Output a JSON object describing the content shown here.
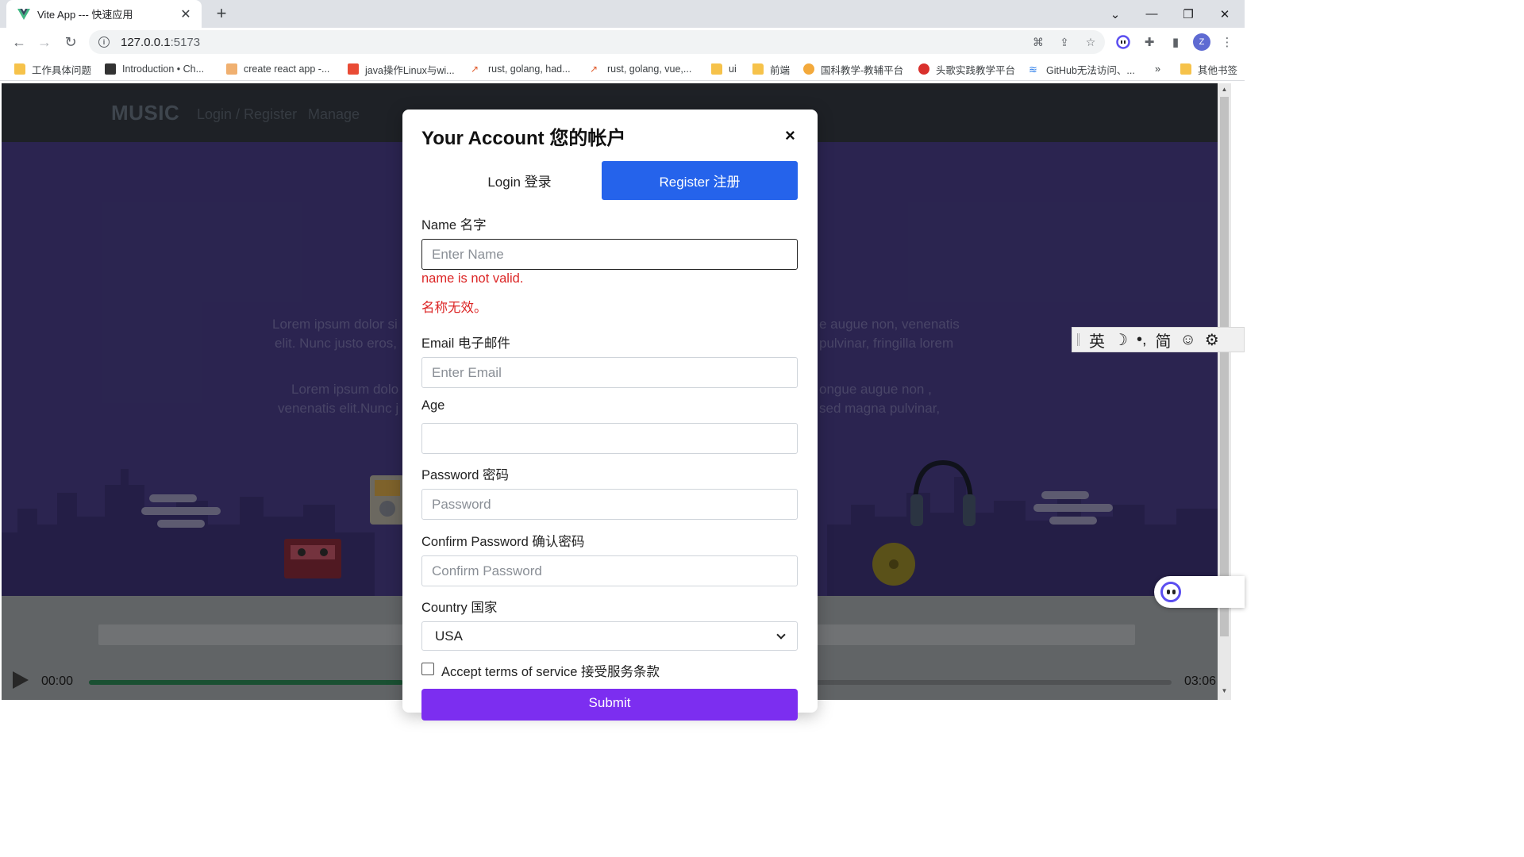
{
  "browser": {
    "tab_title": "Vite App --- 快速应用",
    "url_host": "127.0.0.1",
    "url_port": ":5173",
    "profile_initial": "Z"
  },
  "bookmarks": [
    {
      "label": "工作具体问题",
      "icon": "folder"
    },
    {
      "label": "Introduction • Ch...",
      "icon": "site"
    },
    {
      "label": "create react app -...",
      "icon": "site"
    },
    {
      "label": "java操作Linux与wi...",
      "icon": "site"
    },
    {
      "label": "rust, golang, had...",
      "icon": "site"
    },
    {
      "label": "rust, golang, vue,...",
      "icon": "site"
    },
    {
      "label": "ui",
      "icon": "folder"
    },
    {
      "label": "前端",
      "icon": "folder"
    },
    {
      "label": "国科教学-教辅平台",
      "icon": "site"
    },
    {
      "label": "头歌实践教学平台",
      "icon": "site"
    },
    {
      "label": "GitHub无法访问、...",
      "icon": "site"
    },
    {
      "label": "»",
      "icon": "none"
    },
    {
      "label": "其他书签",
      "icon": "folder"
    }
  ],
  "site": {
    "brand": "MUSIC",
    "nav_login": "Login / Register",
    "nav_manage": "Manage",
    "hero_left_1": "Lorem ipsum dolor si",
    "hero_left_2": "elit. Nunc justo eros,",
    "hero_left_3": "Lorem ipsum dolo",
    "hero_left_4": "venenatis elit.Nunc j",
    "hero_right_1": "e augue non, venenatis",
    "hero_right_2": "pulvinar, fringilla lorem",
    "hero_right_3": "ongue augue non ,",
    "hero_right_4": "sed magna pulvinar,"
  },
  "player": {
    "current_time": "00:00",
    "total_time": "03:06",
    "progress": 0.29
  },
  "ime": {
    "lang": "英",
    "moon": "☽",
    "punct": "•,",
    "script": "简",
    "emoji": "☺",
    "settings": "⚙"
  },
  "modal": {
    "title": "Your Account 您的帐户",
    "close": "×",
    "tab_login": "Login 登录",
    "tab_register": "Register 注册",
    "name_label": "Name 名字",
    "name_placeholder": "Enter Name",
    "name_error_en": "name is not valid.",
    "name_error_zh": "名称无效。",
    "email_label": "Email 电子邮件",
    "email_placeholder": "Enter Email",
    "age_label": "Age",
    "age_value": "",
    "password_label": "Password 密码",
    "password_placeholder": "Password",
    "confirm_label": "Confirm Password 确认密码",
    "confirm_placeholder": "Confirm Password",
    "country_label": "Country 国家",
    "country_value": "USA",
    "tos_label": "Accept terms of service 接受服务条款",
    "submit_label": "Submit"
  },
  "colors": {
    "accent_blue": "#2563eb",
    "error_red": "#dc2626",
    "submit_purple": "#7c2ef0",
    "header_dark": "#343a42",
    "hero_purple": "#4a3f8a",
    "progress_green": "#2e8b57"
  }
}
